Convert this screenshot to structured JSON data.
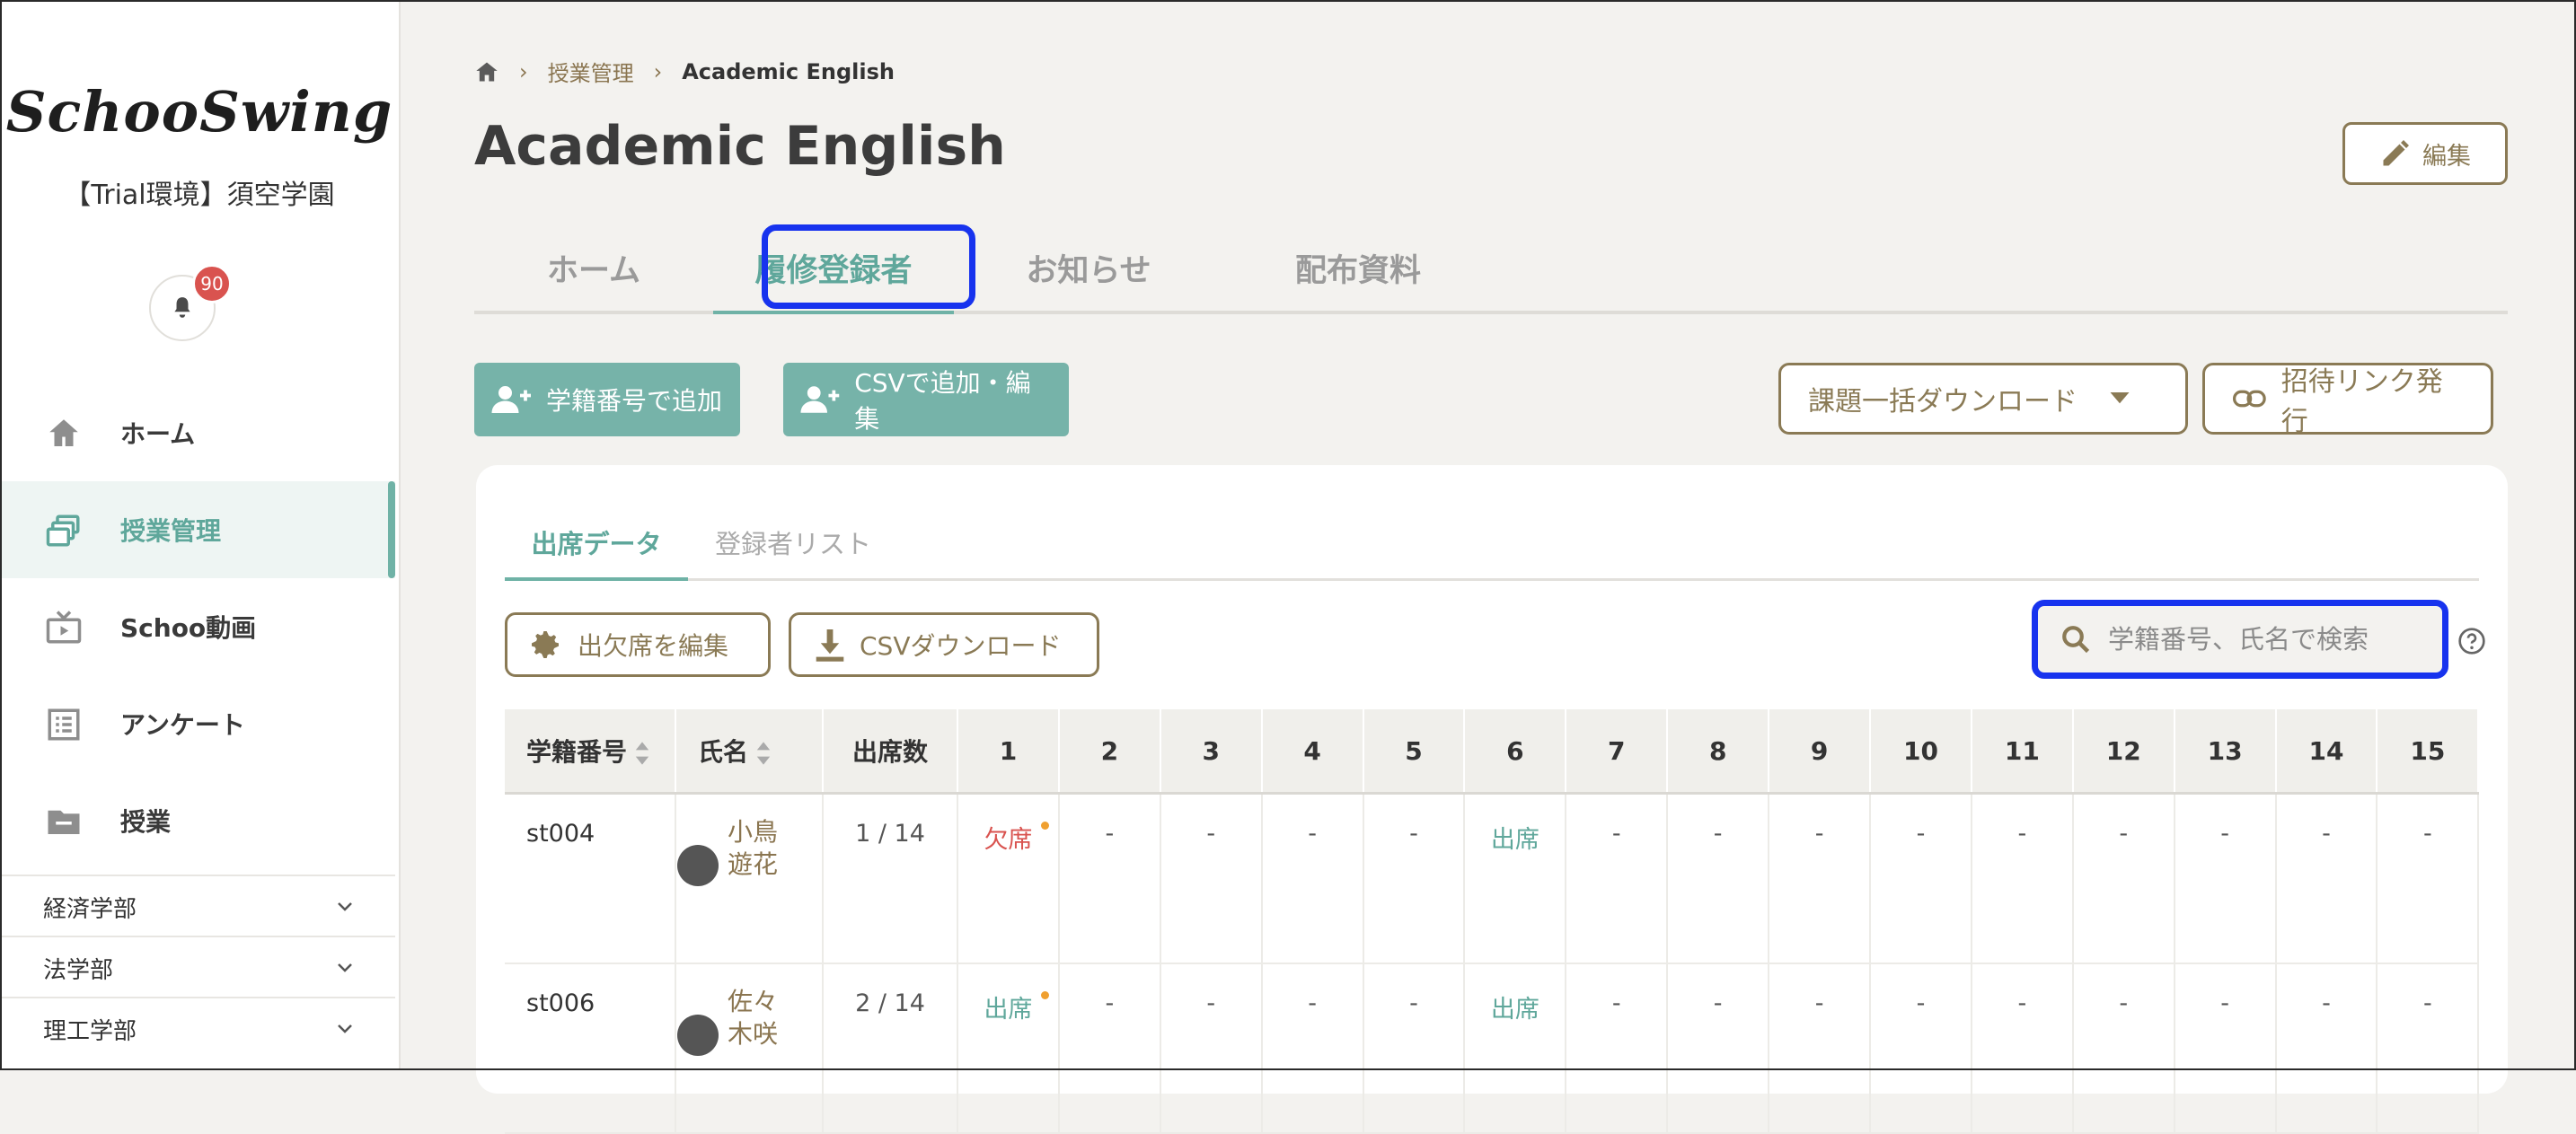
{
  "sidebar": {
    "logo": "SchooSwing",
    "org": "【Trial環境】須空学園",
    "notification_count": "90",
    "nav": [
      {
        "label": "ホーム",
        "icon": "home-icon"
      },
      {
        "label": "授業管理",
        "icon": "class-manage-icon",
        "active": true
      },
      {
        "label": "Schoo動画",
        "icon": "tv-icon"
      },
      {
        "label": "アンケート",
        "icon": "survey-icon"
      },
      {
        "label": "授業",
        "icon": "folder-icon"
      }
    ],
    "departments": [
      "経済学部",
      "法学部",
      "理工学部"
    ]
  },
  "breadcrumb": {
    "level1": "授業管理",
    "current": "Academic English"
  },
  "page": {
    "title": "Academic English",
    "edit_label": "編集"
  },
  "tabs": [
    "ホーム",
    "履修登録者",
    "お知らせ",
    "配布資料"
  ],
  "toolbar": {
    "add_by_id": "学籍番号で追加",
    "add_by_csv": "CSVで追加・編集",
    "bulk_download": "課題一括ダウンロード",
    "invite_link": "招待リンク発行"
  },
  "subtabs": [
    "出席データ",
    "登録者リスト"
  ],
  "actions": {
    "edit_attendance": "出欠席を編集",
    "csv_download": "CSVダウンロード"
  },
  "search": {
    "placeholder": "学籍番号、氏名で検索"
  },
  "table": {
    "headers": {
      "id": "学籍番号",
      "name": "氏名",
      "count": "出席数"
    },
    "session_numbers": [
      "1",
      "2",
      "3",
      "4",
      "5",
      "6",
      "7",
      "8",
      "9",
      "10",
      "11",
      "12",
      "13",
      "14",
      "15"
    ],
    "rows": [
      {
        "id": "st004",
        "name": "小鳥遊花",
        "count": "1 / 14",
        "sessions": [
          "欠席",
          "-",
          "-",
          "-",
          "-",
          "出席",
          "-",
          "-",
          "-",
          "-",
          "-",
          "-",
          "-",
          "-",
          "-"
        ]
      },
      {
        "id": "st006",
        "name": "佐々木咲",
        "count": "2 / 14",
        "sessions": [
          "出席",
          "-",
          "-",
          "-",
          "-",
          "出席",
          "-",
          "-",
          "-",
          "-",
          "-",
          "-",
          "-",
          "-",
          "-"
        ]
      }
    ]
  },
  "colors": {
    "accent": "#6fb2a6",
    "brown": "#8a7a55",
    "highlight": "#1733ee",
    "absent": "#d9534f"
  }
}
